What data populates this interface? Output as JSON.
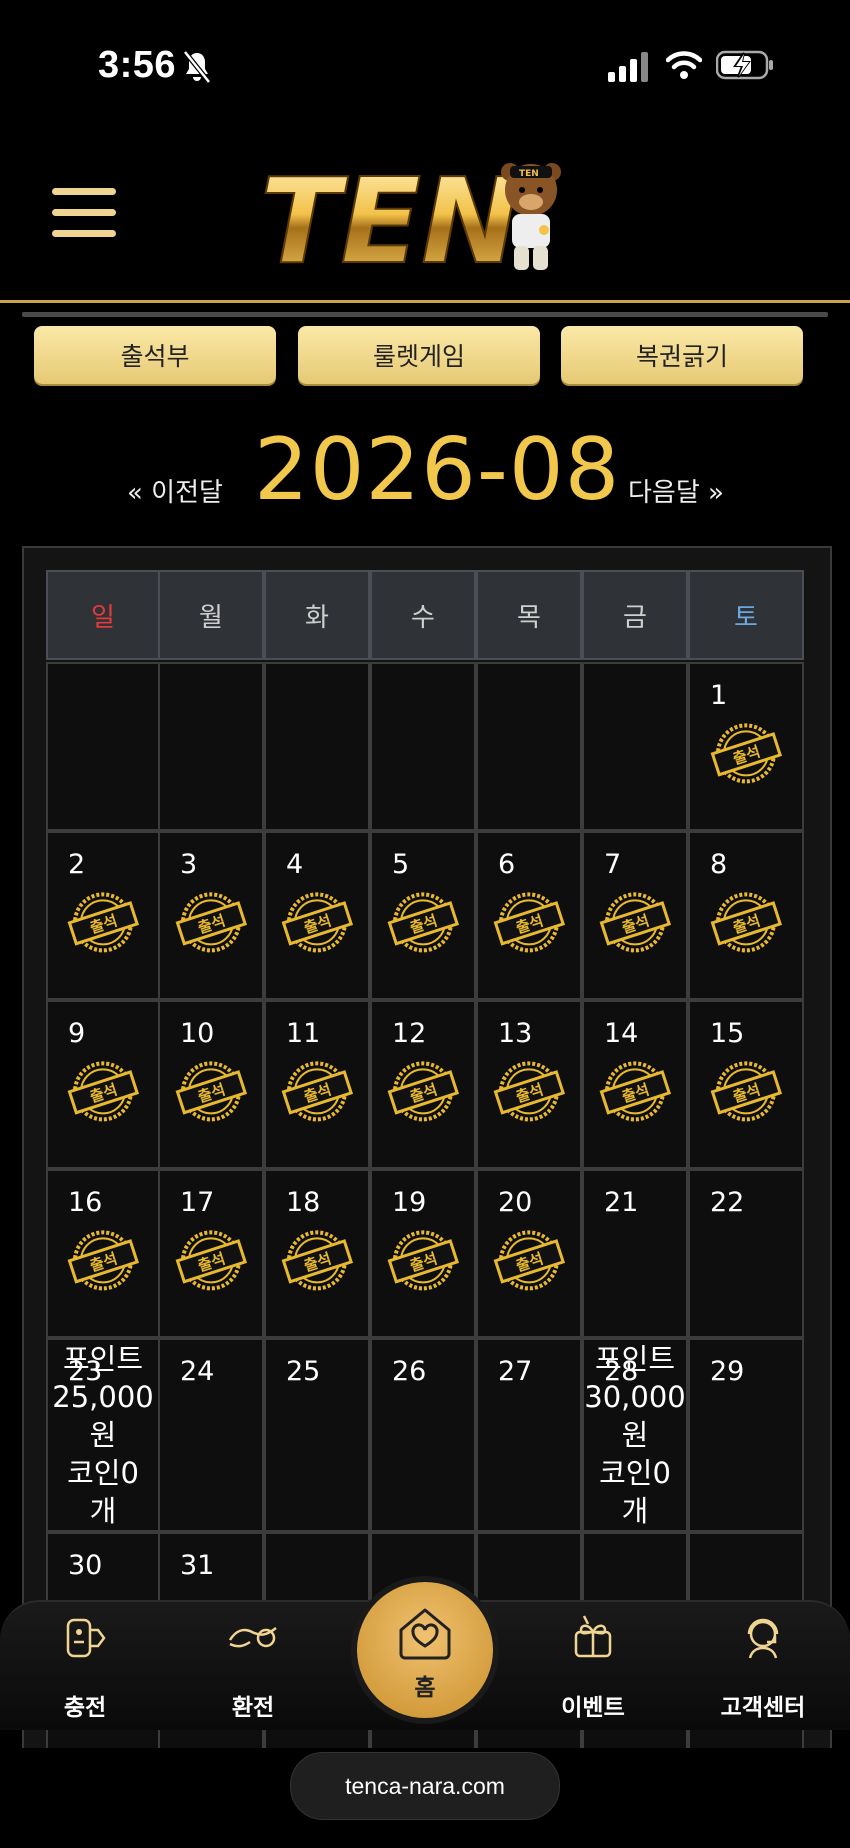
{
  "status": {
    "time": "3:56"
  },
  "header": {
    "logo_text": "TEN",
    "logo_badge": "TEN"
  },
  "top_buttons": [
    "출석부",
    "룰렛게임",
    "복권긁기"
  ],
  "month_nav": {
    "prev": "« 이전달",
    "title": "2026-08",
    "next": "다음달 »"
  },
  "weekdays": [
    {
      "label": "일",
      "color": "#e23b3b"
    },
    {
      "label": "월",
      "color": "#cfcfcf"
    },
    {
      "label": "화",
      "color": "#cfcfcf"
    },
    {
      "label": "수",
      "color": "#cfcfcf"
    },
    {
      "label": "목",
      "color": "#cfcfcf"
    },
    {
      "label": "금",
      "color": "#cfcfcf"
    },
    {
      "label": "토",
      "color": "#6aa9e0"
    }
  ],
  "stamp_text": "출석",
  "calendar": [
    [
      {
        "day": ""
      },
      {
        "day": ""
      },
      {
        "day": ""
      },
      {
        "day": ""
      },
      {
        "day": ""
      },
      {
        "day": ""
      },
      {
        "day": "1",
        "stamp": true
      }
    ],
    [
      {
        "day": "2",
        "stamp": true
      },
      {
        "day": "3",
        "stamp": true
      },
      {
        "day": "4",
        "stamp": true
      },
      {
        "day": "5",
        "stamp": true
      },
      {
        "day": "6",
        "stamp": true
      },
      {
        "day": "7",
        "stamp": true
      },
      {
        "day": "8",
        "stamp": true
      }
    ],
    [
      {
        "day": "9",
        "stamp": true
      },
      {
        "day": "10",
        "stamp": true
      },
      {
        "day": "11",
        "stamp": true
      },
      {
        "day": "12",
        "stamp": true
      },
      {
        "day": "13",
        "stamp": true
      },
      {
        "day": "14",
        "stamp": true
      },
      {
        "day": "15",
        "stamp": true
      }
    ],
    [
      {
        "day": "16",
        "stamp": true
      },
      {
        "day": "17",
        "stamp": true
      },
      {
        "day": "18",
        "stamp": true
      },
      {
        "day": "19",
        "stamp": true
      },
      {
        "day": "20",
        "stamp": true
      },
      {
        "day": "21"
      },
      {
        "day": "22"
      }
    ],
    [
      {
        "day": "23",
        "reward": [
          "포인트",
          "25,000",
          "원",
          "코인0",
          "개"
        ]
      },
      {
        "day": "24"
      },
      {
        "day": "25"
      },
      {
        "day": "26"
      },
      {
        "day": "27"
      },
      {
        "day": "28",
        "reward": [
          "포인트",
          "30,000",
          "원",
          "코인0",
          "개"
        ]
      },
      {
        "day": "29"
      }
    ],
    [
      {
        "day": "30"
      },
      {
        "day": "31"
      },
      {
        "day": ""
      },
      {
        "day": ""
      },
      {
        "day": ""
      },
      {
        "day": ""
      },
      {
        "day": ""
      }
    ]
  ],
  "bottom_nav": {
    "charge": "충전",
    "exchange": "환전",
    "home": "홈",
    "event": "이벤트",
    "support": "고객센터"
  },
  "url": "tenca-nara.com"
}
